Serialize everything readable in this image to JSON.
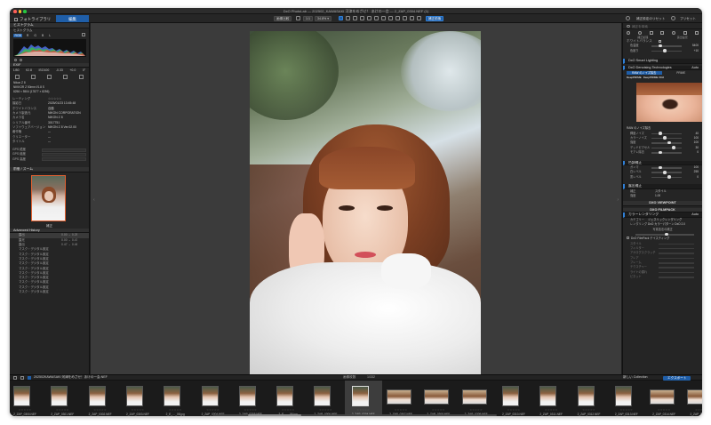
{
  "window": {
    "title": "DxO PhotoLab — 202502_KAWASAKI 河津をめざせ！ あけの一会 — 2_ZAP_0304.NEF (1)"
  },
  "toolbar": {
    "tab_library": "フォトライブラリ",
    "tab_edit": "編集",
    "compare_btn": "画像比較",
    "zoom_btn": "34.8% ▾",
    "fit_btn": "1:1",
    "before_after": "補正前後",
    "export_btn": "書き出しをする",
    "settings_btn": "補正設定のリセット",
    "presets_btn": "プリセット"
  },
  "left_panel": {
    "histogram": {
      "title": "ヒストグラム",
      "subtitle": "ヒストグラム",
      "modes": [
        "RGB",
        "R",
        "G",
        "B",
        "L"
      ]
    },
    "exif": {
      "title": "EXIF",
      "values": [
        "1/80",
        "f/2.8",
        "ISO100",
        "-0.33",
        "+0.0",
        "0°"
      ],
      "camera": "Nikon Z 8",
      "lens": "NIKKOR Z 50mm f/1.8 S",
      "date": "2025/01/23 13:45:48",
      "file": "2_ZAP_0304.NEF",
      "dims": "8256 × 5504 (17877 × 8256)",
      "rows": [
        {
          "k": "レーティング",
          "v": "☆☆☆☆☆"
        },
        {
          "k": "撮影日",
          "v": "2025/01/23 13:45:48"
        },
        {
          "k": "ホワイトバランス",
          "v": "自動"
        },
        {
          "k": "カメラ製造元",
          "v": "NIKON CORPORATION"
        },
        {
          "k": "カメラ名",
          "v": "NIKON Z 8"
        },
        {
          "k": "シリアル番号",
          "v": "3017751"
        },
        {
          "k": "ソフトウェアバージョン",
          "v": "NIKON Z 8 Ver.02.00"
        },
        {
          "k": "著作権",
          "v": "—"
        },
        {
          "k": "クリエーター",
          "v": "—"
        },
        {
          "k": "タイトル",
          "v": "—"
        }
      ],
      "gps": [
        {
          "k": "GPS 緯度"
        },
        {
          "k": "GPS 経度"
        },
        {
          "k": "GPS 高度"
        }
      ]
    },
    "navigator": {
      "title": "ナビゲーター",
      "sub": "前後 / ズーム",
      "label": "補正"
    },
    "history": {
      "title": "Advanced History",
      "items": [
        {
          "name": "露出",
          "val": "0.00 → 0.25"
        },
        {
          "name": "露光",
          "val": "0.00 → 0.47"
        },
        {
          "name": "露出",
          "val": "0.47 → 0.46"
        },
        {
          "name": "マスク・デジタル設定"
        },
        {
          "name": "マスク・デジタル設定"
        },
        {
          "name": "マスク・デジタル設定"
        },
        {
          "name": "マスク・デジタル設定"
        },
        {
          "name": "マスク・デジタル設定"
        },
        {
          "name": "マスク・デジタル設定"
        },
        {
          "name": "マスク・デジタル設定"
        },
        {
          "name": "マスク・デジタル設定"
        },
        {
          "name": "マスク・デジタル設定"
        },
        {
          "name": "マスク・デジタル設定"
        }
      ]
    }
  },
  "right_panel": {
    "search": "補正を検索",
    "tabs_label": [
      "補正処理",
      "露出設定"
    ],
    "eyedropper": "ホワイトバランス",
    "rows_top": [
      {
        "name": "色温度",
        "val": "5400"
      },
      {
        "name": "色被り",
        "val": "+10"
      }
    ],
    "sections": {
      "smart_lighting": "DxO Smart Lighting",
      "denoise": "DxO Denoising Technologies",
      "denoise_mode": "Auto",
      "denoise_opts": [
        "RAW",
        "HQ",
        "PRIME",
        "DeepPRIME",
        "DeepPRIME XD2"
      ],
      "denoise_sel": "DeepPRIME XD2",
      "denoise_sub": "RAW のノイズ除去",
      "sharpen_rows": [
        {
          "name": "輝度ノイズ",
          "val": "40"
        },
        {
          "name": "カラーノイズ",
          "val": "100"
        },
        {
          "name": "強度",
          "val": "100"
        },
        {
          "name": "デッドピクセル",
          "val": "30"
        },
        {
          "name": "モアレ除去",
          "val": "0"
        }
      ],
      "tone_title": "色調補正",
      "tone_rows": [
        {
          "name": "ガンマ",
          "val": "100"
        },
        {
          "name": "白レベル",
          "val": "255"
        },
        {
          "name": "黒レベル",
          "val": "0"
        }
      ],
      "pen_title": "露出補正",
      "pen_rows": [
        {
          "name": "補正",
          "val": "スタイル"
        },
        {
          "name": "強度",
          "val": "1.00"
        }
      ],
      "viewpoint": "DXO VIEWPOINT",
      "filmpack": "DXO FILMPACK",
      "color_render": "カラーレンダリング",
      "color_render_mode": "Auto",
      "color_rows": [
        {
          "name": "カテゴリー",
          "val": "ジェネリックレンダリング"
        },
        {
          "name": "レンダリング",
          "val": "DxO カラーパターン DxO 2.0"
        }
      ],
      "color_sub": "写真技法の補正",
      "color_sub2": "DxO FilmPack テイスティング",
      "style_rows": [
        {
          "name": "スタイル"
        },
        {
          "name": "フィルター"
        },
        {
          "name": "アナログスクラッチ"
        },
        {
          "name": "フレア"
        },
        {
          "name": "フレーム"
        },
        {
          "name": "テクスチャー"
        },
        {
          "name": "ライトの漏れ"
        },
        {
          "name": "ビネット"
        }
      ]
    }
  },
  "filmstrip": {
    "folder": "202502KAWASAKI 河津をめざせ！あけの一会.NEF",
    "counter": "1/332",
    "center_label": "画像枚数",
    "collection": "新しい Collection",
    "export_btn": "エクスポート",
    "thumbs": [
      {
        "name": "2_ZAP_0300.NEF",
        "o": "v"
      },
      {
        "name": "2_ZAP_0301.NEF",
        "o": "v"
      },
      {
        "name": "2_ZAP_0302.NEF",
        "o": "v"
      },
      {
        "name": "2_ZAP_0303.NEF",
        "o": "v"
      },
      {
        "name": "2_E_…_08.jpg",
        "o": "v"
      },
      {
        "name": "2_ZAP_0304.NEF",
        "o": "v"
      },
      {
        "name": "2_ZAP_0305.NEF",
        "o": "v"
      },
      {
        "name": "2_E_…_06.jpg",
        "o": "v"
      },
      {
        "name": "2_ZAP_0306.NEF",
        "o": "v"
      },
      {
        "name": "2_ZAP_0304.NEF",
        "o": "v",
        "sel": true
      },
      {
        "name": "2_ZAP_0307.NEF",
        "o": "h"
      },
      {
        "name": "2_ZAP_0308.NEF",
        "o": "h"
      },
      {
        "name": "2_ZAP_0309.NEF",
        "o": "h"
      },
      {
        "name": "2_ZAP_0310.NEF",
        "o": "v"
      },
      {
        "name": "2_ZAP_0311.NEF",
        "o": "v"
      },
      {
        "name": "2_ZAP_0312.NEF",
        "o": "v"
      },
      {
        "name": "2_ZAP_0313.NEF",
        "o": "v"
      },
      {
        "name": "2_ZAP_0314.NEF",
        "o": "h"
      },
      {
        "name": "2_ZAP_0315.NEF",
        "o": "h"
      }
    ]
  },
  "colors": {
    "accent": "#1f5ea8",
    "panel": "#252525",
    "canvas": "#3b3b3b"
  }
}
